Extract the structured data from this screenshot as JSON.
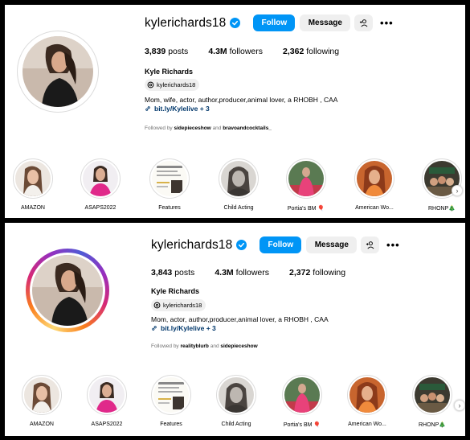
{
  "colors": {
    "follow_button": "#0095f6",
    "secondary_button": "#efefef",
    "verified_badge": "#0095f6",
    "link": "#00376b",
    "muted_text": "#737373"
  },
  "panels": [
    {
      "username": "kylerichards18",
      "follow_label": "Follow",
      "message_label": "Message",
      "more_label": "•••",
      "stats": {
        "posts_count": "3,839",
        "posts_label": "posts",
        "followers_count": "4.3M",
        "followers_label": "followers",
        "following_count": "2,362",
        "following_label": "following"
      },
      "full_name": "Kyle Richards",
      "threads_handle": "kylerichards18",
      "bio": "Mom, wife, actor, author,producer,animal lover, a RHOBH , CAA",
      "link": "bit.ly/Kylelive + 3",
      "followed_by_prefix": "Followed by",
      "followed_by_user1": "sidepieceshow",
      "followed_by_and": "and",
      "followed_by_user2": "bravoandcocktails_",
      "highlights": [
        {
          "label": "AMAZON",
          "icon": "woman-photo"
        },
        {
          "label": "ASAPS2022",
          "icon": "woman-pink-dress"
        },
        {
          "label": "Features",
          "icon": "magazine-cover"
        },
        {
          "label": "Child Acting",
          "icon": "black-white-portrait"
        },
        {
          "label": "Portia's BM 🎈",
          "icon": "party-photo"
        },
        {
          "label": "American Wo...",
          "icon": "woman-orange"
        },
        {
          "label": "RHONP🎄",
          "icon": "group-photo"
        }
      ]
    },
    {
      "username": "kylerichards18",
      "follow_label": "Follow",
      "message_label": "Message",
      "more_label": "•••",
      "stats": {
        "posts_count": "3,843",
        "posts_label": "posts",
        "followers_count": "4.3M",
        "followers_label": "followers",
        "following_count": "2,372",
        "following_label": "following"
      },
      "full_name": "Kyle Richards",
      "threads_handle": "kylerichards18",
      "bio": "Mom, actor, author,producer,animal lover, a RHOBH , CAA",
      "link": "bit.ly/Kylelive + 3",
      "followed_by_prefix": "Followed by",
      "followed_by_user1": "realityblurb",
      "followed_by_and": "and",
      "followed_by_user2": "sidepieceshow",
      "highlights": [
        {
          "label": "AMAZON",
          "icon": "woman-photo"
        },
        {
          "label": "ASAPS2022",
          "icon": "woman-pink-dress"
        },
        {
          "label": "Features",
          "icon": "magazine-cover"
        },
        {
          "label": "Child Acting",
          "icon": "black-white-portrait"
        },
        {
          "label": "Portia's BM 🎈",
          "icon": "party-photo"
        },
        {
          "label": "American Wo...",
          "icon": "woman-orange"
        },
        {
          "label": "RHONP🎄",
          "icon": "group-photo"
        }
      ]
    }
  ]
}
